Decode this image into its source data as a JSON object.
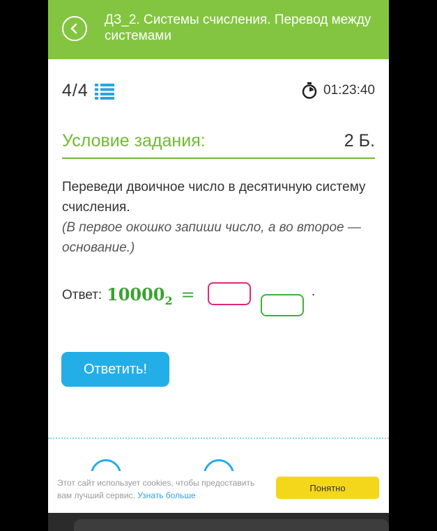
{
  "header": {
    "title": "ДЗ_2. Системы счисления. Перевод между системами"
  },
  "progress": {
    "current": "4",
    "separator": "/",
    "total": "4"
  },
  "timer": {
    "value": "01:23:40"
  },
  "condition": {
    "title": "Условие задания:",
    "points": "2 Б."
  },
  "task": {
    "text": "Переведи двоичное число в десятичную систему счисления.",
    "hint": "(В первое окошко запиши число, а во второе — основание.)"
  },
  "answer": {
    "label": "Ответ:",
    "number": "10000",
    "base": "2",
    "equals": "=",
    "end_dot": ".",
    "first_box_value": "",
    "second_box_value": ""
  },
  "submit": {
    "label": "Ответить!"
  },
  "cookie": {
    "text": "Этот сайт использует cookies, чтобы предоставить вам лучший сервис.",
    "more_link": "Узнать больше",
    "accept_label": "Понятно"
  },
  "colors": {
    "header": "#83c540",
    "accent_green": "#6fbb2f",
    "submit_blue": "#24aee8",
    "box1_border": "#e0287a",
    "box2_border": "#3cb23c",
    "cookie_button": "#f4d71b"
  },
  "icons": {
    "back": "back-arrow-icon",
    "list": "list-icon",
    "timer": "stopwatch-icon"
  }
}
